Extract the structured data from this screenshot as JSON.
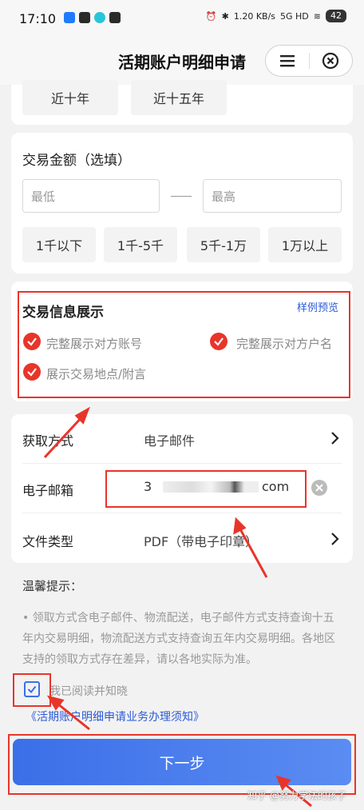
{
  "status_bar": {
    "time": "17:10",
    "network_speed": "1.20 KB/s",
    "network_type": "5G HD",
    "battery": "42"
  },
  "nav": {
    "title": "活期账户明细申请",
    "menu_icon": "menu-icon",
    "close_icon": "close-circle-icon"
  },
  "period_chips": [
    "近十年",
    "近十五年"
  ],
  "amount": {
    "title": "交易金额（选填）",
    "min_placeholder": "最低",
    "max_placeholder": "最高",
    "chips": [
      "1千以下",
      "1千-5千",
      "5千-1万",
      "1万以上"
    ]
  },
  "display": {
    "title": "交易信息展示",
    "preview_link": "样例预览",
    "options": [
      "完整展示对方账号",
      "完整展示对方户名",
      "展示交易地点/附言"
    ]
  },
  "fields": {
    "method_label": "获取方式",
    "method_value": "电子邮件",
    "email_label": "电子邮箱",
    "email_value_start": "3",
    "email_value_end": "com",
    "filetype_label": "文件类型",
    "filetype_value": "PDF（带电子印章）"
  },
  "notice": {
    "title": "温馨提示：",
    "body": "• 领取方式含电子邮件、物流配送，电子邮件方式支持查询十五年内交易明细，物流配送方式支持查询五年内交易明细。各地区支持的领取方式存在差异，请以各地实际为准。"
  },
  "agreement": {
    "checked_text": "我已阅读并知晓",
    "link_text": "《活期账户明细申请业务办理须知》"
  },
  "next_button": "下一步",
  "watermark": "知乎 @努力学法的孩子",
  "colors": {
    "accent_red": "#e8352a",
    "link_blue": "#2a5bd7",
    "button_blue": "#4a7cee"
  }
}
